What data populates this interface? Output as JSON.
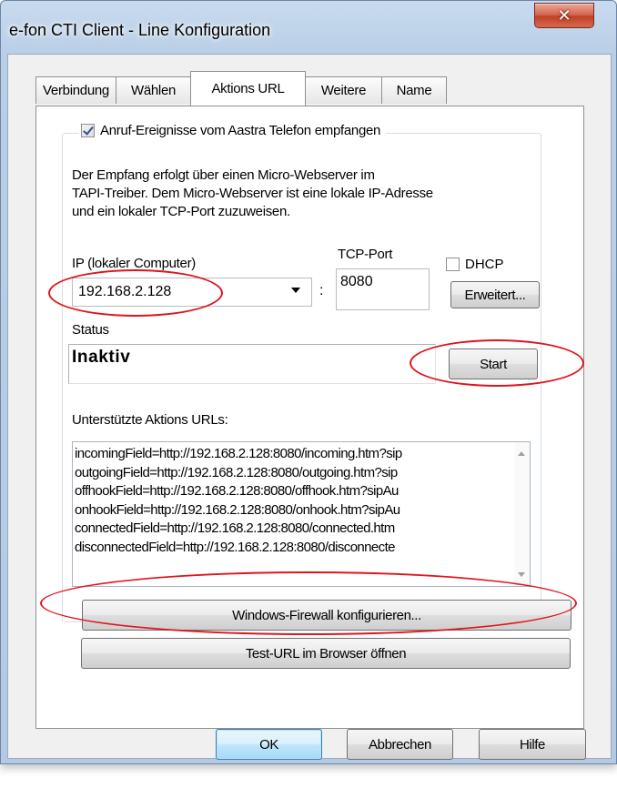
{
  "window": {
    "title": "e-fon CTI Client - Line Konfiguration",
    "close_symbol": "✕"
  },
  "tabs": [
    {
      "label": "Verbindung"
    },
    {
      "label": "Wählen"
    },
    {
      "label": "Aktions URL"
    },
    {
      "label": "Weitere"
    },
    {
      "label": "Name"
    }
  ],
  "group": {
    "checkbox_label": "Anruf-Ereignisse vom Aastra Telefon empfangen",
    "checked": true,
    "description_lines": [
      "Der Empfang erfolgt über einen Micro-Webserver im",
      "TAPI-Treiber. Dem Micro-Webserver ist eine lokale IP-Adresse",
      "und ein lokaler TCP-Port zuzuweisen."
    ],
    "ip_label": "IP  (lokaler Computer)",
    "ip_value": "192.168.2.128",
    "colon": ":",
    "port_label": "TCP-Port",
    "port_value": "8080",
    "dhcp_label": "DHCP",
    "advanced_button": "Erweitert...",
    "status_label": "Status",
    "status_value": "Inaktiv",
    "start_button": "Start",
    "urls_label": "Unterstützte Aktions URLs:",
    "urls": [
      "incomingField=http://192.168.2.128:8080/incoming.htm?sip",
      "outgoingField=http://192.168.2.128:8080/outgoing.htm?sip",
      "offhookField=http://192.168.2.128:8080/offhook.htm?sipAu",
      "onhookField=http://192.168.2.128:8080/onhook.htm?sipAu",
      "connectedField=http://192.168.2.128:8080/connected.htm",
      "disconnectedField=http://192.168.2.128:8080/disconnecte"
    ]
  },
  "buttons": {
    "firewall": "Windows-Firewall konfigurieren...",
    "test_url": "Test-URL im Browser öffnen",
    "ok": "OK",
    "cancel": "Abbrechen",
    "help": "Hilfe"
  },
  "annotation_color": "#e0141c"
}
